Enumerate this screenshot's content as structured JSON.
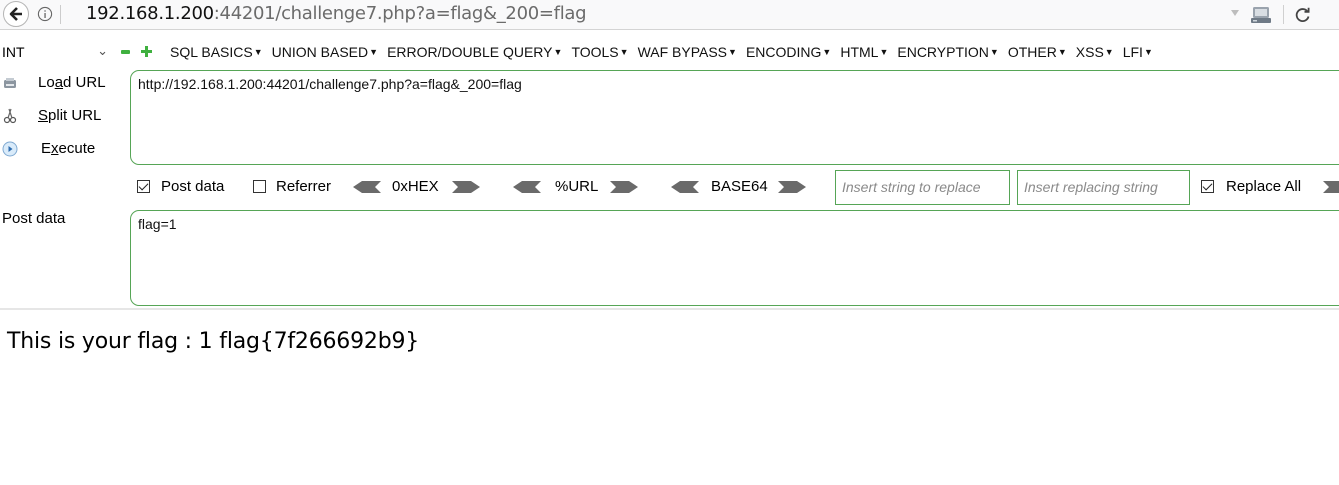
{
  "address_bar": {
    "url_host": "192.168.1.200",
    "url_rest": ":44201/challenge7.php?a=flag&_200=flag"
  },
  "hackbar": {
    "int_select": "INT",
    "menu": [
      "SQL BASICS",
      "UNION BASED",
      "ERROR/DOUBLE QUERY",
      "TOOLS",
      "WAF BYPASS",
      "ENCODING",
      "HTML",
      "ENCRYPTION",
      "OTHER",
      "XSS",
      "LFI"
    ],
    "buttons": {
      "load_url": {
        "pre": "Lo",
        "u": "a",
        "post": "d URL"
      },
      "split_url": {
        "pre": "",
        "u": "S",
        "post": "plit URL"
      },
      "execute": {
        "pre": "E",
        "u": "x",
        "post": "ecute"
      }
    },
    "url_value": "http://192.168.1.200:44201/challenge7.php?a=flag&_200=flag",
    "options": {
      "post_data_label": "Post data",
      "post_data_checked": true,
      "referrer_label": "Referrer",
      "referrer_checked": false,
      "hex_label": "0xHEX",
      "url_label": "%URL",
      "base64_label": "BASE64",
      "replace_placeholder": "Insert string to replace",
      "replacing_placeholder": "Insert replacing string",
      "replace_all_label": "Replace All",
      "replace_all_checked": true
    },
    "post_label": "Post data",
    "post_value": "flag=1"
  },
  "page": {
    "text": "This is your flag : 1 flag{7f266692b9}"
  },
  "colors": {
    "accent_green": "#56a556",
    "arrow_gray": "#6a6a6a"
  }
}
